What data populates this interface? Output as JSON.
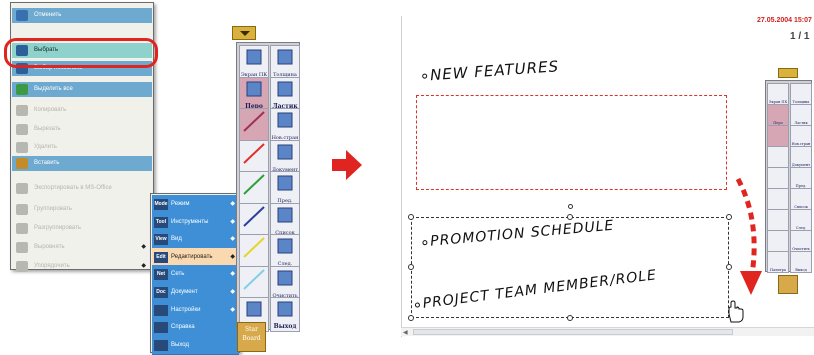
{
  "context_menu": {
    "items": [
      {
        "label": "Отменить",
        "state": "hl",
        "icon": "undo-icon"
      },
      {
        "label": "",
        "state": "normal",
        "icon": ""
      },
      {
        "label": "Выбрать",
        "state": "sel",
        "icon": "select-arrow-icon"
      },
      {
        "label": "Выбор несколько",
        "state": "hl",
        "icon": "multi-select-icon"
      },
      {
        "label": "Выделить все",
        "state": "hl",
        "icon": "select-all-icon"
      },
      {
        "label": "Копировать",
        "state": "dis",
        "icon": "copy-icon"
      },
      {
        "label": "Вырезать",
        "state": "dis",
        "icon": "cut-icon"
      },
      {
        "label": "Удалить",
        "state": "dis",
        "icon": "delete-icon"
      },
      {
        "label": "Вставить",
        "state": "hl",
        "icon": "paste-icon"
      },
      {
        "label": "Экспортировать в MS-Office",
        "state": "dis",
        "icon": "export-icon"
      },
      {
        "label": "Группировать",
        "state": "dis",
        "icon": "group-icon"
      },
      {
        "label": "Разгруппировать",
        "state": "dis",
        "icon": "ungroup-icon"
      },
      {
        "label": "Выровнять",
        "state": "dis",
        "icon": "align-icon",
        "arrow": "◆"
      },
      {
        "label": "Упорядочить",
        "state": "dis",
        "icon": "order-icon",
        "arrow": "◆"
      }
    ]
  },
  "submenu": {
    "items": [
      {
        "tag": "Mode",
        "label": "Режим",
        "arrow": "◆",
        "active": false
      },
      {
        "tag": "Tool",
        "label": "Инструменты",
        "arrow": "◆",
        "active": false
      },
      {
        "tag": "View",
        "label": "Вид",
        "arrow": "◆",
        "active": false
      },
      {
        "tag": "Edit",
        "label": "Редактировать",
        "arrow": "◆",
        "active": true
      },
      {
        "tag": "Net",
        "label": "Сеть",
        "arrow": "◆",
        "active": false
      },
      {
        "tag": "Doc",
        "label": "Документ",
        "arrow": "◆",
        "active": false
      },
      {
        "tag": "",
        "label": "Настройки",
        "arrow": "◆",
        "active": false
      },
      {
        "tag": "",
        "label": "Справка",
        "arrow": "",
        "active": false
      },
      {
        "tag": "",
        "label": "Выход",
        "arrow": "",
        "active": false
      }
    ]
  },
  "toolbar": {
    "buttons": [
      {
        "label": "Экран ПК",
        "icon": "screen-pc-icon",
        "bold": false
      },
      {
        "label": "Толщина",
        "icon": "thickness-icon",
        "bold": false
      },
      {
        "label": "Перо",
        "icon": "pen-icon",
        "bold": true
      },
      {
        "label": "Ластик",
        "icon": "eraser-icon",
        "bold": true
      },
      {
        "label": "",
        "icon": "pen-color-icon",
        "bold": false
      },
      {
        "label": "Нов.стран",
        "icon": "new-page-icon",
        "bold": false
      },
      {
        "label": "",
        "icon": "red-line-icon",
        "bold": false
      },
      {
        "label": "Документ",
        "icon": "document-icon",
        "bold": false
      },
      {
        "label": "",
        "icon": "green-line-icon",
        "bold": false
      },
      {
        "label": "Пред.",
        "icon": "prev-icon",
        "bold": false
      },
      {
        "label": "",
        "icon": "blue-line-icon",
        "bold": false
      },
      {
        "label": "Список",
        "icon": "list-icon",
        "bold": false
      },
      {
        "label": "",
        "icon": "yellow-line-icon",
        "bold": false
      },
      {
        "label": "След.",
        "icon": "next-icon",
        "bold": false
      },
      {
        "label": "",
        "icon": "cyan-line-icon",
        "bold": false
      },
      {
        "label": "Очистить",
        "icon": "clear-icon",
        "bold": false
      },
      {
        "label": "Палитра",
        "icon": "palette-icon",
        "bold": false
      },
      {
        "label": "Выход",
        "icon": "exit-icon",
        "bold": true
      }
    ],
    "starboard_label": "Star Board"
  },
  "board": {
    "date": "27.05.2004 15:07",
    "page": "1 / 1",
    "lines": [
      "NEW FEATURES",
      "PROMOTION SCHEDULE",
      "PROJECT TEAM MEMBER/ROLE"
    ]
  },
  "mini_toolbar": {
    "labels": [
      "Экран ПК",
      "Толщина",
      "Перо",
      "Ластик",
      "",
      "Нов.стран",
      "",
      "Документ",
      "",
      "Пред.",
      "",
      "Список",
      "",
      "След.",
      "",
      "Очистить",
      "Палитра",
      "Выход"
    ]
  },
  "colors": {
    "accent_blue": "#3e8fd6",
    "highlight_teal": "#8fd2cc",
    "callout_red": "#e02420",
    "toolbar_gold": "#d8b23c"
  }
}
